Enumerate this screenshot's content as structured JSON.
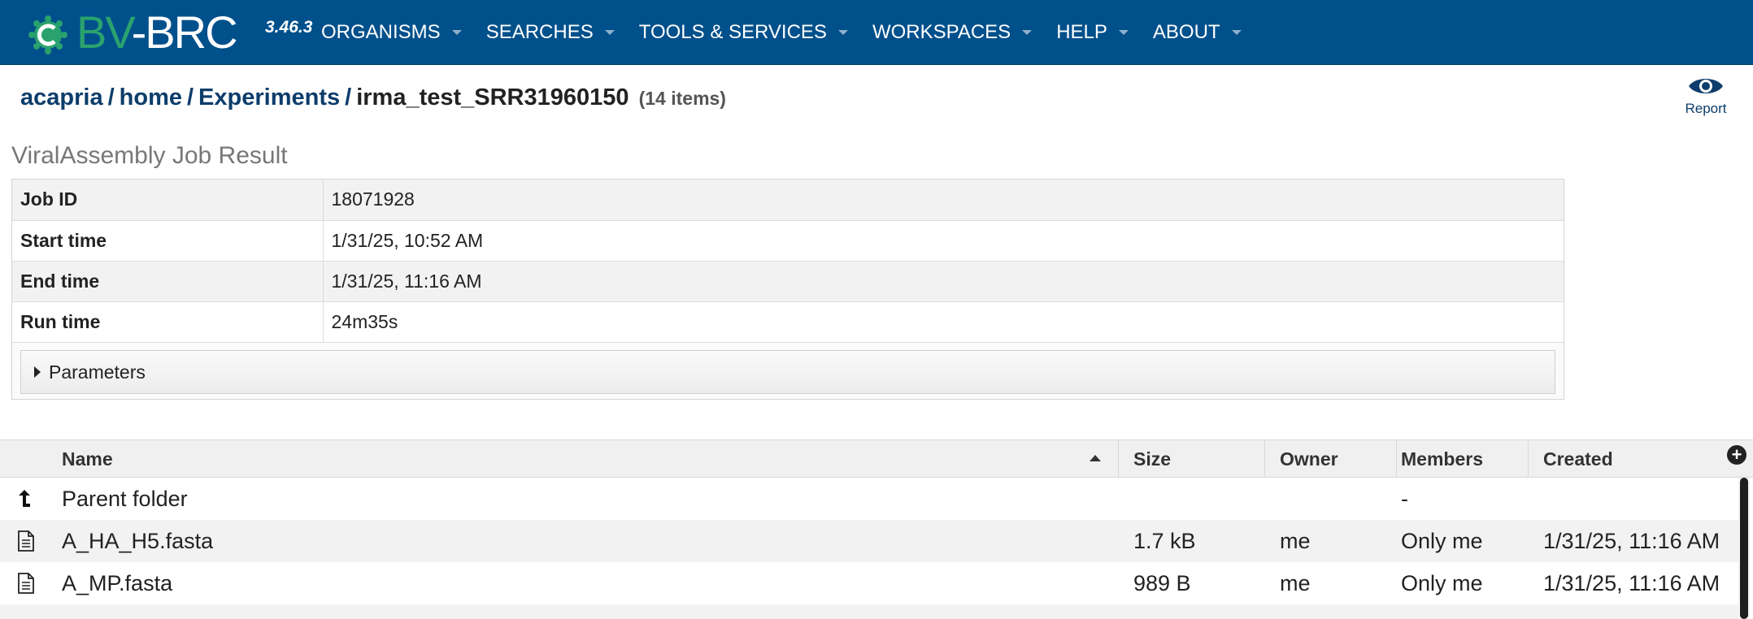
{
  "app": {
    "logo_bv": "BV",
    "logo_brc": "-BRC",
    "version": "3.46.3"
  },
  "nav": {
    "items": [
      "ORGANISMS",
      "SEARCHES",
      "TOOLS & SERVICES",
      "WORKSPACES",
      "HELP",
      "ABOUT"
    ]
  },
  "breadcrumb": {
    "parts": [
      "acapria",
      "home",
      "Experiments"
    ],
    "current": "irma_test_SRR31960150",
    "count": "(14 items)"
  },
  "report": {
    "label": "Report",
    "icon": "eye-icon"
  },
  "job": {
    "title": "ViralAssembly Job Result",
    "rows": [
      {
        "key": "Job ID",
        "value": "18071928"
      },
      {
        "key": "Start time",
        "value": "1/31/25, 10:52 AM"
      },
      {
        "key": "End time",
        "value": "1/31/25, 11:16 AM"
      },
      {
        "key": "Run time",
        "value": "24m35s"
      }
    ],
    "parameters_label": "Parameters"
  },
  "grid": {
    "columns": [
      "Name",
      "Size",
      "Owner",
      "Members",
      "Created"
    ],
    "sort": "Name ascending",
    "rows": [
      {
        "icon": "parent-folder-icon",
        "name": "Parent folder",
        "size": "",
        "owner": "",
        "members": "-",
        "created": ""
      },
      {
        "icon": "file-icon",
        "name": "A_HA_H5.fasta",
        "size": "1.7 kB",
        "owner": "me",
        "members": "Only me",
        "created": "1/31/25, 11:16 AM"
      },
      {
        "icon": "file-icon",
        "name": "A_MP.fasta",
        "size": "989 B",
        "owner": "me",
        "members": "Only me",
        "created": "1/31/25, 11:16 AM"
      }
    ]
  },
  "colors": {
    "header_bg": "#00508b",
    "logo_green": "#2aa26e",
    "link": "#0c3d6b"
  }
}
